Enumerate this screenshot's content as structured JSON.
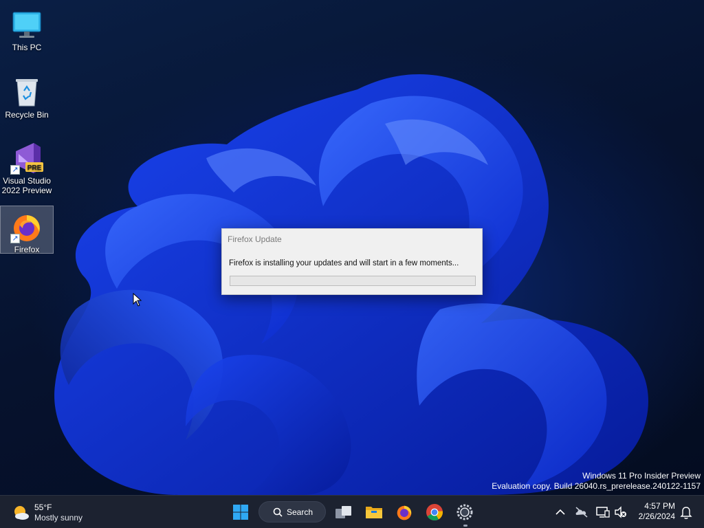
{
  "desktop": {
    "icons": [
      {
        "label": "This PC"
      },
      {
        "label": "Recycle Bin"
      },
      {
        "label": "Visual Studio\n2022 Preview",
        "line1": "Visual Studio",
        "line2": "2022 Preview",
        "badge": "PRE"
      },
      {
        "label": "Firefox"
      }
    ]
  },
  "dialog": {
    "title": "Firefox Update",
    "message": "Firefox is installing your updates and will start in a few moments...",
    "progress": 0
  },
  "watermark": {
    "line1": "Windows 11 Pro Insider Preview",
    "line2": "Evaluation copy. Build 26040.rs_prerelease.240122-1157"
  },
  "taskbar": {
    "weather": {
      "temp": "55°F",
      "desc": "Mostly sunny",
      "icon": "sun-cloud-icon"
    },
    "search_label": "Search",
    "pinned": [
      "start",
      "task-view",
      "file-explorer",
      "firefox",
      "chrome",
      "firefox-updater"
    ],
    "clock": {
      "time": "4:57 PM",
      "date": "2/26/2024"
    },
    "tray": [
      "chevron-up-icon",
      "onedrive-offline-icon",
      "network-icon",
      "volume-muted-icon",
      "notifications-icon"
    ]
  },
  "colors": {
    "accent": "#1a5fd0",
    "taskbar": "#1c2230",
    "dialog_bg": "#f0f0f0",
    "wallpaper_bloom": "#1e46e6"
  }
}
